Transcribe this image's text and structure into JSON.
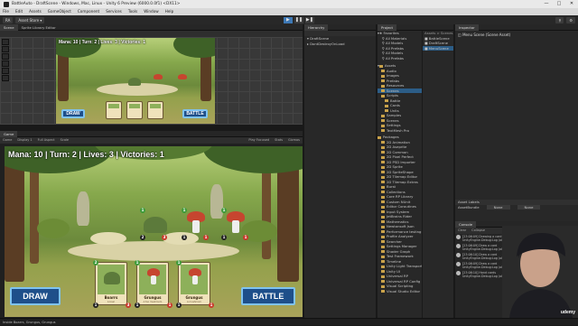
{
  "window": {
    "title": "BattleAuto - DraftScene - Windows, Mac, Linux - Unity 6 Preview (6000.0.0f1) <DX11>"
  },
  "menu": [
    "File",
    "Edit",
    "Assets",
    "GameObject",
    "Component",
    "Services",
    "Tools",
    "Window",
    "Help"
  ],
  "toolbar": {
    "account": "RA",
    "asset_store": "Asset Store ▾"
  },
  "scene_panel": {
    "tabs": [
      "Scene",
      "Sprite Library Editor"
    ]
  },
  "game_panel": {
    "tab": "Game",
    "display": "Game",
    "display_sel": "Display 1",
    "aspect": "Full Aspect",
    "scale_label": "Scale",
    "play_focused": "Play Focused",
    "stats": "Stats",
    "gizmos": "Gizmos"
  },
  "game": {
    "hud_text": "Mana: 10 | Turn: 2 | Lives: 3 | Victories: 1",
    "draw_btn": "DRAW",
    "battle_btn": "BATTLE",
    "cards": [
      {
        "name": "Boarrs",
        "desc": "A boar",
        "cost": "2",
        "atk": "1",
        "hp": "3",
        "art": "hedgehog"
      },
      {
        "name": "Grungus",
        "desc": "A fun mushroom",
        "cost": "1",
        "atk": "1",
        "hp": "1",
        "art": "mushroom"
      },
      {
        "name": "Grungus",
        "desc": "A mushroom",
        "cost": "1",
        "atk": "1",
        "hp": "1",
        "art": "mushroom"
      }
    ],
    "units": [
      {
        "art": "hedgehog",
        "top": "1",
        "atk": "2",
        "hp": "3"
      },
      {
        "art": "mushroom",
        "top": "1",
        "atk": "1",
        "hp": "1"
      },
      {
        "art": "mushroom",
        "top": "1",
        "atk": "1",
        "hp": "1"
      }
    ]
  },
  "hierarchy": {
    "tab": "Hierarchy",
    "items": [
      "DraftScene",
      "DontDestroyOnLoad"
    ]
  },
  "project": {
    "tab": "Project",
    "favorites": [
      "Favorites",
      "All Materials",
      "All Models",
      "All Prefabs",
      "All Models",
      "All Prefabs"
    ],
    "assets_tree": [
      "Assets",
      "Audio",
      "Images",
      "Prefabs",
      "Resources",
      "Scenes",
      "Scripts",
      "Battle",
      "Cards",
      "Units",
      "Samples",
      "Scenes",
      "Settings",
      "TextMesh Pro"
    ],
    "packages": [
      "Packages",
      "2D Animation",
      "2D Aseprite",
      "2D Common",
      "2D Pixel Perfect",
      "2D PSD Importer",
      "2D Sprite",
      "2D SpriteShape",
      "2D Tilemap Editor",
      "2D Tilemap Extras",
      "Burst",
      "Collections",
      "Core RP Library",
      "Custom NUnit",
      "Editor Coroutines",
      "Input System",
      "JetBrains Rider",
      "Mathematics",
      "Newtonsoft Json",
      "Performance testing",
      "Profile Analyzer",
      "Searcher",
      "Settings Manager",
      "Shader Graph",
      "Test Framework",
      "Timeline",
      "Unity Light Transport",
      "Unity UI",
      "Universal RP",
      "Universal RP Config",
      "Visual Scripting",
      "Visual Studio Editor"
    ],
    "breadcrumb": "Assets > Scenes",
    "files": [
      "BattleScene",
      "DraftScene",
      "MenuScene"
    ]
  },
  "inspector": {
    "tab": "Inspector",
    "title": "Menu Scene (Scene Asset)",
    "asset_labels": "Asset Labels",
    "asset_bundle": "AssetBundle",
    "none1": "None",
    "none2": "None"
  },
  "console": {
    "tab": "Console",
    "clear": "Clear",
    "collapse": "Collapse",
    "lines": [
      "[23:06:09] Drawing a card\nUnityEngine.Debug:Log (object)",
      "[23:06:09] Draw a card\nUnityEngine.Debug:Log (object)",
      "[23:06:10] Draw a card\nUnityEngine.Debug:Log (object)",
      "[23:06:09] Draw a card\nUnityEngine.Debug:Log (object)",
      "[23:06:10] Hand cards\nUnityEngine.Debug:Log (object)"
    ]
  },
  "status": {
    "text": "Inside Boarrs, Grungus, Grungus"
  },
  "watermark": "udemy",
  "colors": {
    "editor_bg": "#282828",
    "selection": "#2c5d87",
    "game_button": "#1e4f8a",
    "folder": "#c9a24a"
  }
}
